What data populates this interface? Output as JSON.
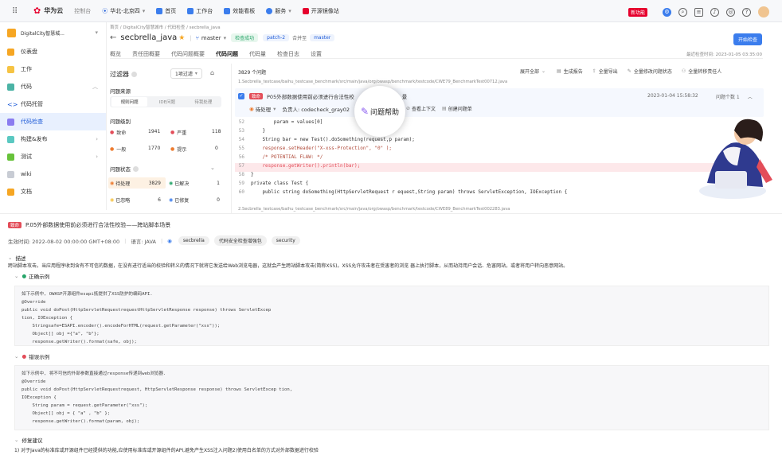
{
  "topbar": {
    "brand": "华为云",
    "console": "控制台",
    "region": "华北-北京四",
    "nav": [
      "首页",
      "工作台",
      "效能看板",
      "服务",
      "开源镜像站"
    ],
    "badge": "新功能"
  },
  "sidebar": {
    "project": "DigitalCity智慧城...",
    "items": [
      {
        "label": "仪表盘"
      },
      {
        "label": "工作"
      },
      {
        "label": "代码"
      },
      {
        "label": "代码托管"
      },
      {
        "label": "代码检查"
      },
      {
        "label": "构建&发布"
      },
      {
        "label": "测试"
      },
      {
        "label": "wiki"
      },
      {
        "label": "文档"
      }
    ]
  },
  "main": {
    "breadcrumb": "首页 / DigitalCity智慧城市 / 代码检查 / secbrella_java",
    "repo": "secbrella_java",
    "branch": "master",
    "status_pill": "检查成功",
    "patch_pill": "patch-2",
    "merge_to": "合并至",
    "master_pill": "master",
    "start_button": "开始检查",
    "tabs": [
      "概览",
      "责任田概要",
      "代码问题概要",
      "代码问题",
      "代码量",
      "检查日志",
      "设置"
    ],
    "last_check": "最近检查时间: 2023-01-05 03:35:00",
    "filter": {
      "title": "过滤器",
      "dropdown": "1项过滤",
      "source_title": "问题来源",
      "source_tabs": [
        "规则问题",
        "IDE问题",
        "待我处理"
      ],
      "level_title": "问题级别",
      "levels": [
        {
          "label": "致命",
          "count": "1941",
          "color": "#e34d59"
        },
        {
          "label": "严重",
          "count": "118",
          "color": "#e34d59"
        },
        {
          "label": "一般",
          "count": "1770",
          "color": "#ed7b2f"
        },
        {
          "label": "提示",
          "count": "0",
          "color": "#ed7b2f"
        }
      ],
      "status_title": "问题状态",
      "statuses": [
        {
          "label": "待处理",
          "count": "3829"
        },
        {
          "label": "已解决",
          "count": "1"
        },
        {
          "label": "已忽略",
          "count": "6"
        },
        {
          "label": "已修复",
          "count": "0"
        }
      ]
    },
    "issues": {
      "count": "3829 个问题",
      "expand_all": "展开全部",
      "actions": [
        "生成报告",
        "全量导出",
        "全量修改问题状态",
        "全量转移责任人"
      ],
      "file1": "1.Secbrella_testcase/baihu_testcase_benchmark/src/main/java/org/owasp/benchmark/testcode/CWE79_BenchmarkTest00712.java",
      "issue_badge": "致命",
      "issue_title": "P05外部数据使用前必须进行合法性校",
      "issue_title_tail": "景",
      "issue_time": "2023-01-04 15:58:32",
      "issue_count": "问题个数 1",
      "status": "待处理",
      "owner": "负责人: codecheck_gray02",
      "help": "问题帮助",
      "context": "查看上下文",
      "create": "创建问题单",
      "code": [
        {
          "ln": "52",
          "text": "        param = values[0]"
        },
        {
          "ln": "53",
          "text": "    }"
        },
        {
          "ln": "54",
          "text": "    String bar = new Test().doSomething(request,p param);"
        },
        {
          "ln": "55",
          "text": "    response.setHeader(\"X-xss-Protection\", \"0\" );"
        },
        {
          "ln": "56",
          "text": "    /* POTENTIAL FLAW: */"
        },
        {
          "ln": "57",
          "text": "    response.getWriter().println(bar);"
        },
        {
          "ln": "58",
          "text": "}"
        },
        {
          "ln": "59",
          "text": "private class Test {"
        },
        {
          "ln": "60",
          "text": "    public string doSomething(HttpServletRequest r equest,String param) throws ServletException, IOException {"
        }
      ],
      "file2": "2.Secbrella_testcase/baihu_testcase_benchmark/src/main/java/org/owasp/benchmark/testcode/CWE89_BenchmarkTest002283.java"
    }
  },
  "help": {
    "badge": "致命",
    "title": "P.05外部数据使用前必须进行合法性校验——跨站脚本场景",
    "effective": "生效时间: 2022-08-02 00:00:00 GMT+08:00",
    "lang": "语言: JAVA",
    "tags": [
      "secbrella",
      "代码安全检查增强包",
      "security"
    ],
    "desc_title": "描述",
    "desc": "跨站脚本攻击。当应用程序收到含有不可信的数据，在没有进行适当的校验和转义的情况下就将它发送给Web浏览电器，这就会产生跨站脚本攻击(简称XSS)。XSS允许攻击者在受害者的浏览 器上执行脚本，从而劫持用户会话、危害网站，或者将用户转向恶意网站。",
    "good_title": "正确示例",
    "good_code": "如下示例中, OWASP开源组件esapi抵提供了XSS防护的编码API.\n@Override\npublic void doPost(HttpServletRequestrequestHttpServletResponse response) throws ServletExcep\ntion, IOException {\n    Stringsafe=ESAPI.encoder().encodeForHTML(request.getParameter(\"xss\"));\n    Object[] obj ={\"a\", \"b\"};\n    response.getWriter().format(safe, obj);",
    "bad_title": "错误示例",
    "bad_code": "如下示例中, 将不可信的外部参数直接通过response传递到web浏览器.\n@Override\npublic void doPost(HttpServletRequestrequest, HttpServletResponse response) throws ServletExcep tion,\nIOException {\n    String param = request.getParameter(\"xss\");\n    Object[] obj = { \"a\" , \"b\" };\n    response.getWriter().format(param, obj);",
    "fix_title": "修复建议",
    "fix": "1) 对于Java的标准库或开源组件已经提供的功能,应使用标准库或开源组件的API,避免产生XSS注入问题2)使用白名单的方式对外部数据进行校验"
  },
  "colors": {
    "brand": "#e6002d",
    "accent": "#1e5bd8",
    "danger": "#e34d59",
    "warn": "#ed7b2f"
  }
}
